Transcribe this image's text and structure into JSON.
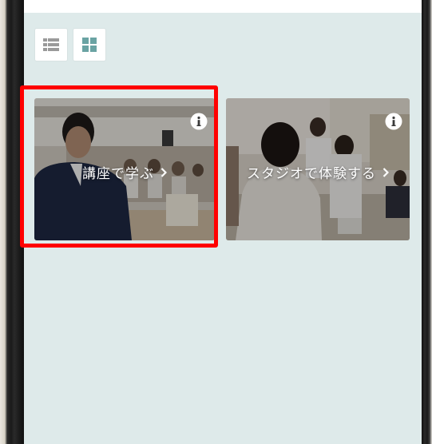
{
  "view_toggles": [
    {
      "name": "list-view",
      "icon": "list-icon",
      "active": false
    },
    {
      "name": "grid-view",
      "icon": "grid-icon",
      "active": true
    }
  ],
  "cards": [
    {
      "label": "講座で学ぶ",
      "info_icon": "info-icon",
      "chevron_icon": "chevron-right-icon",
      "selected": true
    },
    {
      "label": "スタジオで体験する",
      "info_icon": "info-icon",
      "chevron_icon": "chevron-right-icon",
      "selected": false
    }
  ],
  "colors": {
    "screen_bg": "#deeaea",
    "toggle_list": "#9a9a9a",
    "toggle_grid_active": "#6aa3a3",
    "highlight": "#ff0000",
    "card_text": "#ffffff"
  }
}
